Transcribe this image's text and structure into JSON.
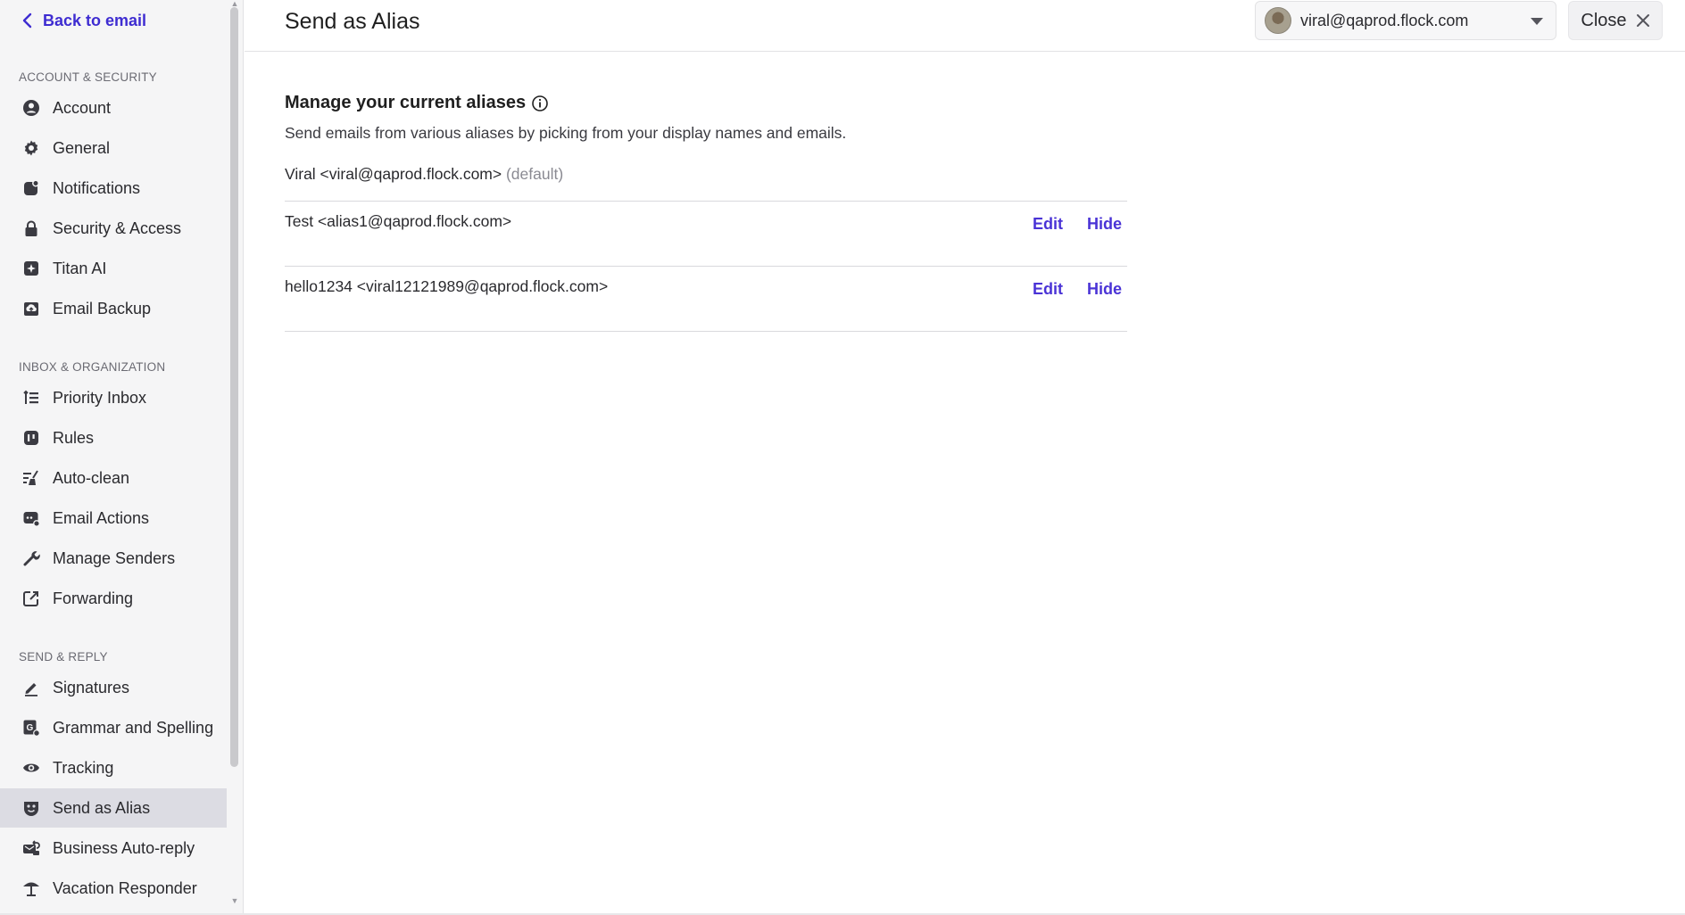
{
  "sidebar": {
    "back_label": "Back to email",
    "sections": [
      {
        "heading": "ACCOUNT & SECURITY",
        "items": [
          {
            "label": "Account",
            "icon": "account-icon"
          },
          {
            "label": "General",
            "icon": "gear-icon"
          },
          {
            "label": "Notifications",
            "icon": "notification-icon"
          },
          {
            "label": "Security & Access",
            "icon": "lock-icon"
          },
          {
            "label": "Titan AI",
            "icon": "sparkle-icon"
          },
          {
            "label": "Email Backup",
            "icon": "backup-icon"
          }
        ]
      },
      {
        "heading": "INBOX & ORGANIZATION",
        "items": [
          {
            "label": "Priority Inbox",
            "icon": "priority-list-icon"
          },
          {
            "label": "Rules",
            "icon": "rules-icon"
          },
          {
            "label": "Auto-clean",
            "icon": "broom-icon"
          },
          {
            "label": "Email Actions",
            "icon": "email-actions-icon"
          },
          {
            "label": "Manage Senders",
            "icon": "wrench-icon"
          },
          {
            "label": "Forwarding",
            "icon": "forward-icon"
          }
        ]
      },
      {
        "heading": "SEND & REPLY",
        "items": [
          {
            "label": "Signatures",
            "icon": "pen-icon"
          },
          {
            "label": "Grammar and Spelling",
            "icon": "grammar-icon"
          },
          {
            "label": "Tracking",
            "icon": "eye-icon"
          },
          {
            "label": "Send as Alias",
            "icon": "alias-mask-icon",
            "active": true
          },
          {
            "label": "Business Auto-reply",
            "icon": "auto-reply-icon"
          },
          {
            "label": "Vacation Responder",
            "icon": "umbrella-icon"
          }
        ]
      }
    ]
  },
  "header": {
    "title": "Send as Alias",
    "account_email": "viral@qaprod.flock.com",
    "close_label": "Close"
  },
  "main": {
    "section_title": "Manage your current aliases",
    "section_description": "Send emails from various aliases by picking from your display names and emails.",
    "default_alias": {
      "text": "Viral <viral@qaprod.flock.com>",
      "tag": "(default)"
    },
    "aliases": [
      {
        "text": "Test <alias1@qaprod.flock.com>",
        "edit_label": "Edit",
        "hide_label": "Hide"
      },
      {
        "text": "hello1234 <viral12121989@qaprod.flock.com>",
        "edit_label": "Edit",
        "hide_label": "Hide"
      }
    ]
  },
  "colors": {
    "accent": "#3e2cd1",
    "sidebar_bg": "#f5f5f6",
    "active_item_bg": "#dcdce3"
  }
}
